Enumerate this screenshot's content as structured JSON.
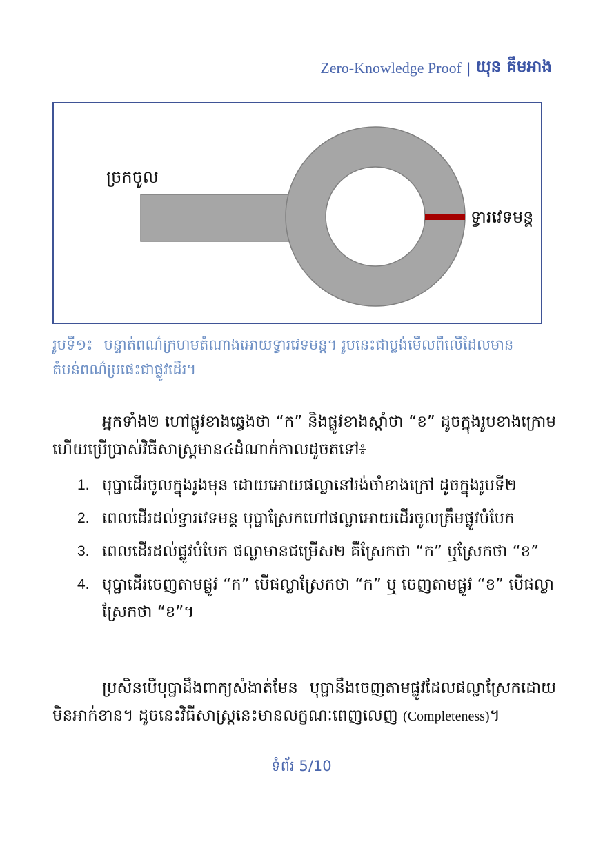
{
  "header": {
    "title": "Zero-Knowledge Proof",
    "separator": "|",
    "author": "យុន គឹមអាង"
  },
  "figure": {
    "entrance_label": "ច្រកចូល",
    "door_label": "ទ្វារវេទមន្ត",
    "colors": {
      "tunnel": "#a6a6a6",
      "door": "#a50000",
      "frame": "#3f5496"
    }
  },
  "caption": {
    "number": "រូបទី១៖",
    "text": "បន្ទាត់ពណ៌ក្រហមតំណាងអោយទ្វារវេទមន្ត។ រូបនេះជាប្លង់មើលពីលើដែលមានតំបន់ពណ៌ប្រផេះជាផ្លូវដើរ។"
  },
  "paragraph1": "អ្នកទាំង២ ហៅផ្លូវខាងឆ្វេងថា “ក” និងផ្លូវខាងស្តាំថា “ខ” ដូចក្នុងរូបខាងក្រោម ហើយប្រើប្រាស់វិធីសាស្ត្រមាន៤ដំណាក់កាលដូចតទៅ៖",
  "steps": [
    {
      "num": "1.",
      "text": "បុប្ផាដើរចូលក្នុងរូងមុន ដោយអោយផល្លានៅរង់ចាំខាងក្រៅ ដូចក្នុងរូបទី២"
    },
    {
      "num": "2.",
      "text": "ពេលដើរដល់ទ្វារវេទមន្ត បុប្ផាស្រែកហៅផល្លាអោយដើរចូលត្រឹមផ្លូវបំបែក"
    },
    {
      "num": "3.",
      "text": "ពេលដើរដល់ផ្លូវបំបែក ផល្លាមានជម្រើស២ គឺស្រែកថា “ក” ឬស្រែកថា “ខ”"
    },
    {
      "num": "4.",
      "text": "បុប្ផាដើរចេញតាមផ្លូវ “ក” បើផល្លាស្រែកថា “ក” ឬ ចេញតាមផ្លូវ “ខ” បើផល្លាស្រែកថា “ខ”។"
    }
  ],
  "paragraph2": {
    "text": "ប្រសិនបើបុប្ផាដឹងពាក្យសំងាត់មែន បុប្ផានឹងចេញតាមផ្លូវដែលផល្លាស្រែកដោយមិនអាក់ខាន។ ដូចនេះវិធីសាស្ត្រនេះមានលក្ខណៈពេញលេញ",
    "term": "(Completeness)",
    "end": "។"
  },
  "footer": {
    "page": "ទំព័រ 5/10"
  }
}
